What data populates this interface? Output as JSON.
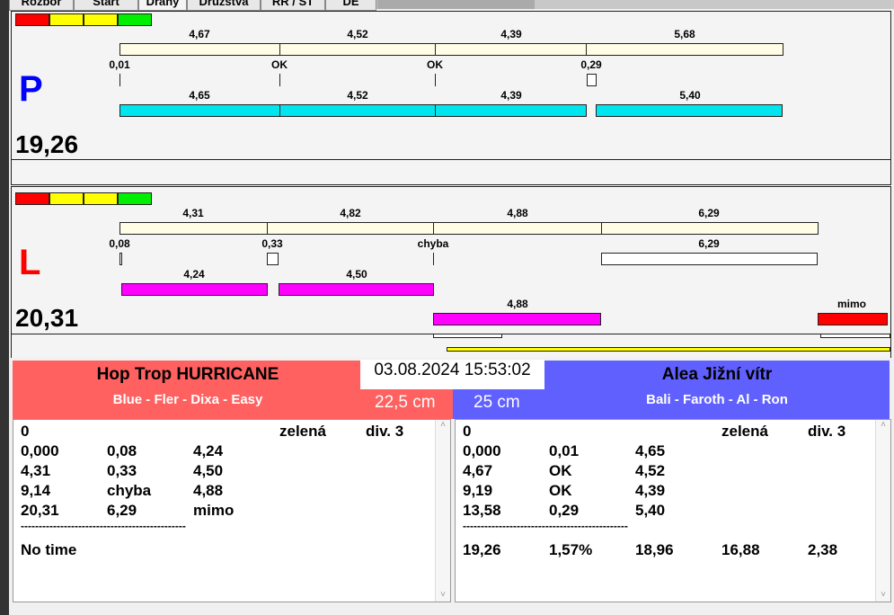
{
  "tabs": [
    "Rozbor",
    "Start",
    "Dráhy",
    "Družstva",
    "RR / ST",
    "DE"
  ],
  "colors": {
    "red": "#ff0000",
    "yellow": "#ffff00",
    "green": "#00e000",
    "cyan": "#00e5ee",
    "magenta": "#ff00ff",
    "cream": "#fffde6",
    "team_left": "#ff6060",
    "team_right": "#6060ff"
  },
  "lane_p": {
    "letter": "P",
    "total": "19,26",
    "top_values": [
      "4,67",
      "4,52",
      "4,39",
      "5,68"
    ],
    "gap_values": [
      "0,01",
      "OK",
      "OK",
      "0,29"
    ],
    "bottom_values": [
      "4,65",
      "4,52",
      "4,39",
      "5,40"
    ]
  },
  "lane_l": {
    "letter": "L",
    "total": "20,31",
    "top_values": [
      "4,31",
      "4,82",
      "4,88",
      "6,29"
    ],
    "gap_values": [
      "0,08",
      "0,33",
      "chyba",
      "6,29"
    ],
    "bottom_values": [
      "4,24",
      "4,50",
      "4,88",
      "mimo"
    ]
  },
  "left_team": {
    "name": "Hop Trop HURRICANE",
    "members": "Blue - Fler - Dixa - Easy",
    "distance": "22,5 cm"
  },
  "right_team": {
    "name": "Alea Jižní vítr",
    "members": "Bali - Faroth - Al - Ron",
    "distance": "25 cm"
  },
  "datetime": "03.08.2024 15:53:02",
  "left_list": {
    "header": [
      "0",
      "zelená",
      "div. 3"
    ],
    "rows": [
      [
        "0,000",
        "0,08",
        "4,24"
      ],
      [
        "4,31",
        "0,33",
        "4,50"
      ],
      [
        "9,14",
        "chyba",
        "4,88"
      ],
      [
        "20,31",
        "6,29",
        "mimo"
      ]
    ],
    "divider": "----------------------------------------------",
    "footer": "No time"
  },
  "right_list": {
    "header": [
      "0",
      "zelená",
      "div. 3"
    ],
    "rows": [
      [
        "0,000",
        "0,01",
        "4,65"
      ],
      [
        "4,67",
        "OK",
        "4,52"
      ],
      [
        "9,19",
        "OK",
        "4,39"
      ],
      [
        "13,58",
        "0,29",
        "5,40"
      ]
    ],
    "divider": "----------------------------------------------",
    "footer": [
      "19,26",
      "1,57%",
      "18,96",
      "16,88",
      "2,38"
    ]
  }
}
